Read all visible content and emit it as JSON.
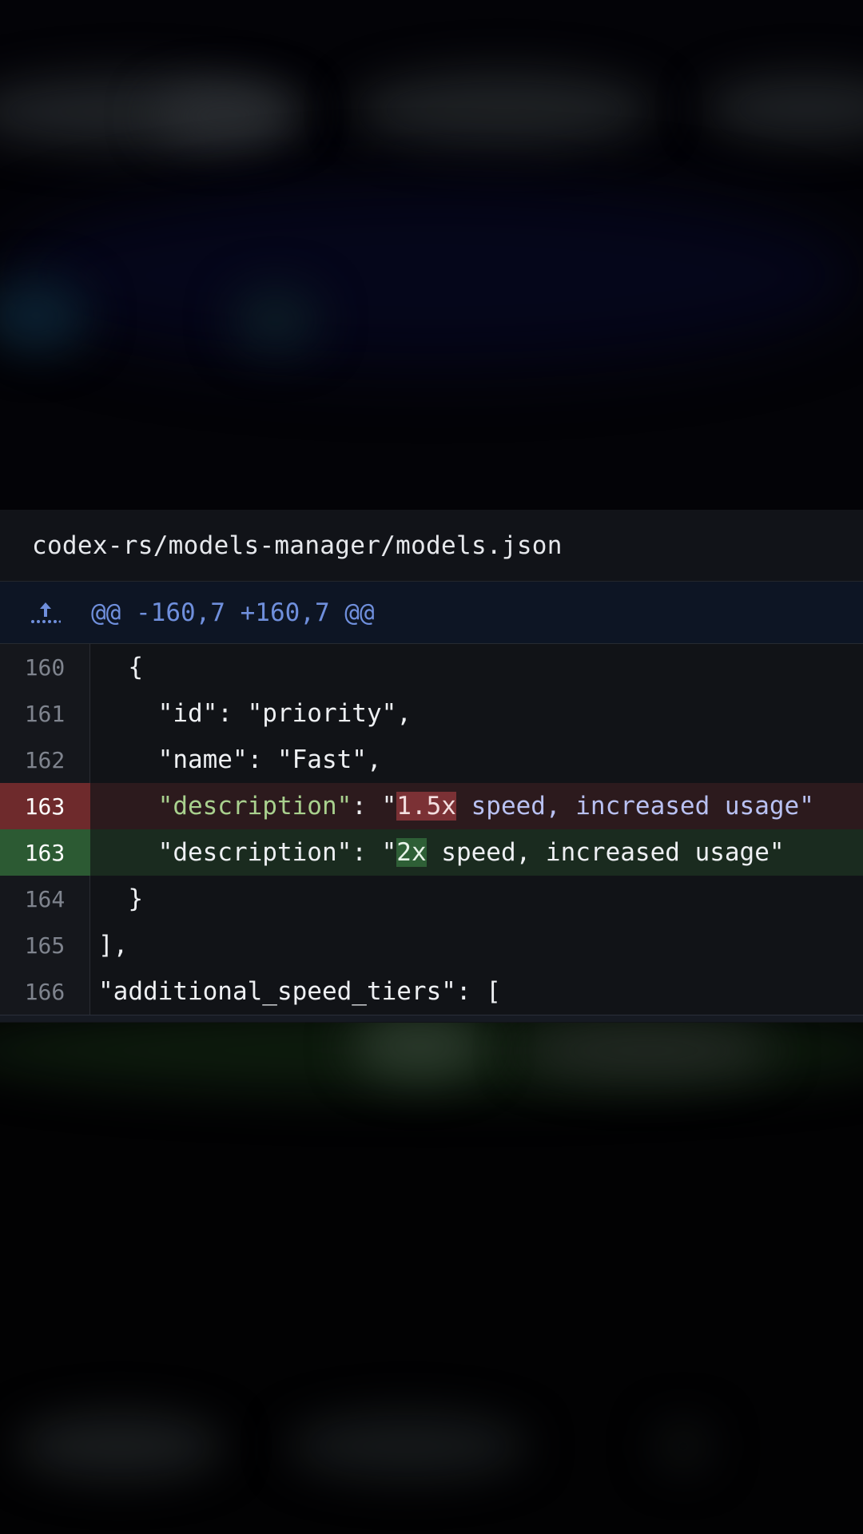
{
  "diff": {
    "file_path": "codex-rs/models-manager/models.json",
    "hunk_header": "@@ -160,7 +160,7 @@",
    "expand_icon": "expand-up-icon",
    "lines": [
      {
        "num": "160",
        "type": "context",
        "indent": "  ",
        "text": "{"
      },
      {
        "num": "161",
        "type": "context",
        "indent": "    ",
        "text": "\"id\": \"priority\","
      },
      {
        "num": "162",
        "type": "context",
        "indent": "    ",
        "text": "\"name\": \"Fast\","
      },
      {
        "num": "163",
        "type": "deletion",
        "indent": "    ",
        "key": "\"description\"",
        "sep": ": \"",
        "changed": "1.5x",
        "rest": " speed, increased usage\""
      },
      {
        "num": "163",
        "type": "addition",
        "indent": "    ",
        "key": "\"description\"",
        "sep": ": \"",
        "changed": "2x",
        "rest": " speed, increased usage\""
      },
      {
        "num": "164",
        "type": "context",
        "indent": "  ",
        "text": "}"
      },
      {
        "num": "165",
        "type": "context",
        "indent": "",
        "text": "],"
      },
      {
        "num": "166",
        "type": "context",
        "indent": "",
        "text": "\"additional_speed_tiers\": ["
      }
    ]
  },
  "colors": {
    "deletion_gutter": "#6e2a2c",
    "addition_gutter": "#2c5a33",
    "hunk_text": "#6f8fdc"
  }
}
